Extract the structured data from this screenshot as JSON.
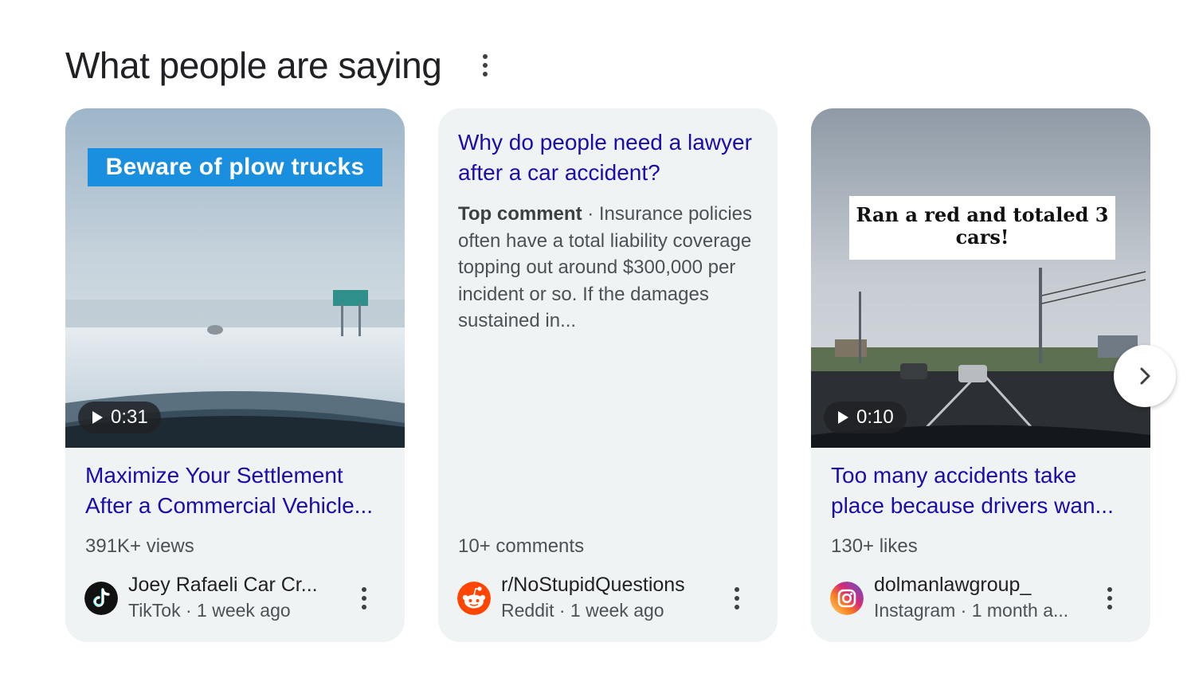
{
  "section": {
    "title": "What people are saying",
    "more_icon": "more-vert-icon"
  },
  "cards": [
    {
      "type": "video",
      "overlay_text": "Beware of plow trucks",
      "duration": "0:31",
      "title": "Maximize Your Settlement After a Commercial Vehicle...",
      "stat": "391K+ views",
      "source_name": "Joey Rafaeli Car Cr...",
      "source_meta": "TikTok · 1 week ago",
      "source_icon": "tiktok-icon"
    },
    {
      "type": "discussion",
      "title": "Why do people need a lawyer after a car accident?",
      "snippet_label": "Top comment",
      "snippet_text": " · Insurance policies often have a total liability coverage topping out around $300,000 per incident or so. If the damages sustained in...",
      "stat": "10+ comments",
      "source_name": "r/NoStupidQuestions",
      "source_meta": "Reddit · 1 week ago",
      "source_icon": "reddit-icon"
    },
    {
      "type": "video",
      "overlay_text": "Ran a red and totaled 3 cars!",
      "duration": "0:10",
      "title": "Too many accidents take place because drivers wan...",
      "stat": "130+ likes",
      "source_name": "dolmanlawgroup_",
      "source_meta": "Instagram · 1 month a...",
      "source_icon": "instagram-icon"
    }
  ],
  "colors": {
    "link": "#1a0dab",
    "card_bg": "#f0f3f4",
    "overlay_blue": "#1a8fe0"
  },
  "next_icon": "chevron-right-icon"
}
